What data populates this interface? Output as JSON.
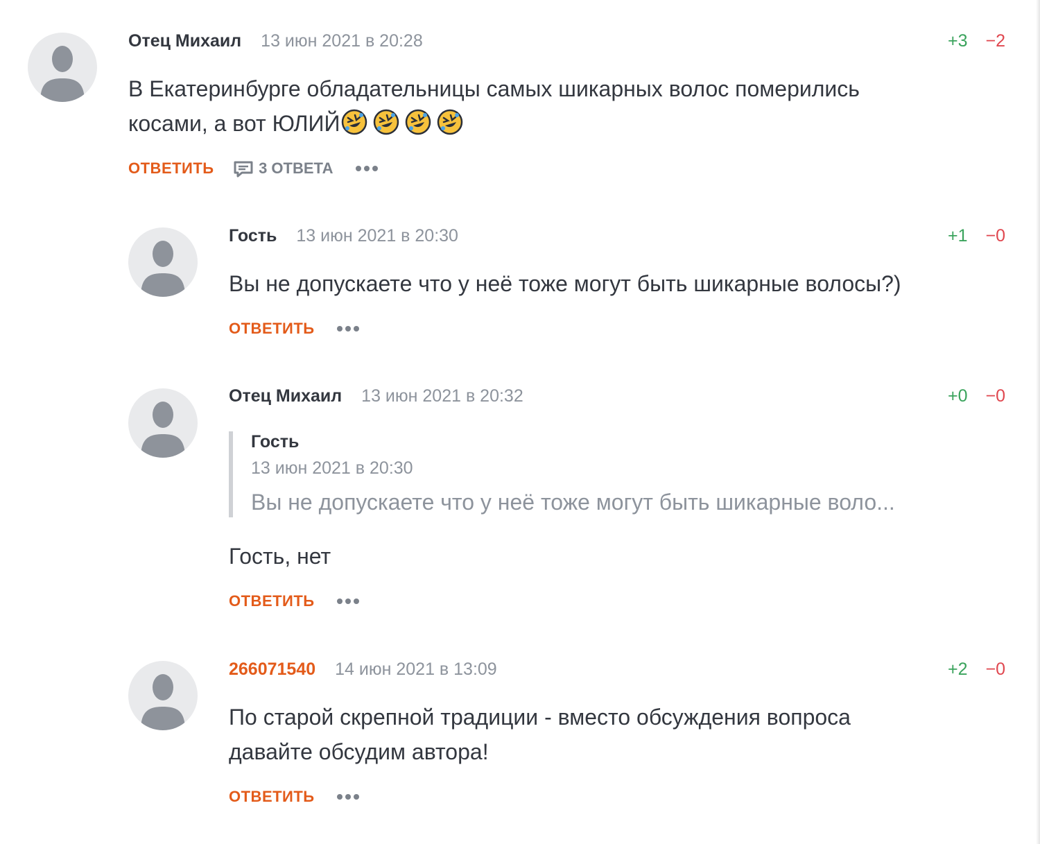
{
  "comments": [
    {
      "author": "Отец Михаил",
      "date": "13 июн 2021 в 20:28",
      "votes": {
        "plus": "+3",
        "minus": "−2"
      },
      "text_line1": "В Екатеринбурге обладательницы самых шикарных волос померились",
      "text_line2": "косами, а вот ЮЛИЙ",
      "emoji": [
        "rolling-on-floor-laughing",
        "rolling-on-floor-laughing",
        "rolling-on-floor-laughing",
        "rolling-on-floor-laughing"
      ],
      "reply_label": "ОТВЕТИТЬ",
      "replies_label": "3 ОТВЕТА"
    },
    {
      "author": "Гость",
      "date": "13 июн 2021 в 20:30",
      "votes": {
        "plus": "+1",
        "minus": "−0"
      },
      "text": "Вы не допускаете что у неё тоже могут быть шикарные волосы?)",
      "reply_label": "ОТВЕТИТЬ"
    },
    {
      "author": "Отец Михаил",
      "date": "13 июн 2021 в 20:32",
      "votes": {
        "plus": "+0",
        "minus": "−0"
      },
      "quote": {
        "author": "Гость",
        "date": "13 июн 2021 в 20:30",
        "text": "Вы не допускаете что у неё тоже могут быть шикарные воло..."
      },
      "text": "Гость, нет",
      "reply_label": "ОТВЕТИТЬ"
    },
    {
      "author": "266071540",
      "date": "14 июн 2021 в 13:09",
      "votes": {
        "plus": "+2",
        "minus": "−0"
      },
      "text_line1": "По старой скрепной традиции - вместо обсуждения вопроса",
      "text_line2": "давайте обсудим автора!",
      "reply_label": "ОТВЕТИТЬ"
    }
  ],
  "icons": {
    "avatar": "user-silhouette-icon",
    "replies": "comment-bubble-icon",
    "more": "more-dots-icon"
  },
  "colors": {
    "accent": "#e35b1a",
    "vote_plus": "#3aa35c",
    "vote_minus": "#e0474f",
    "muted": "#8d939c",
    "text": "#33373f"
  }
}
